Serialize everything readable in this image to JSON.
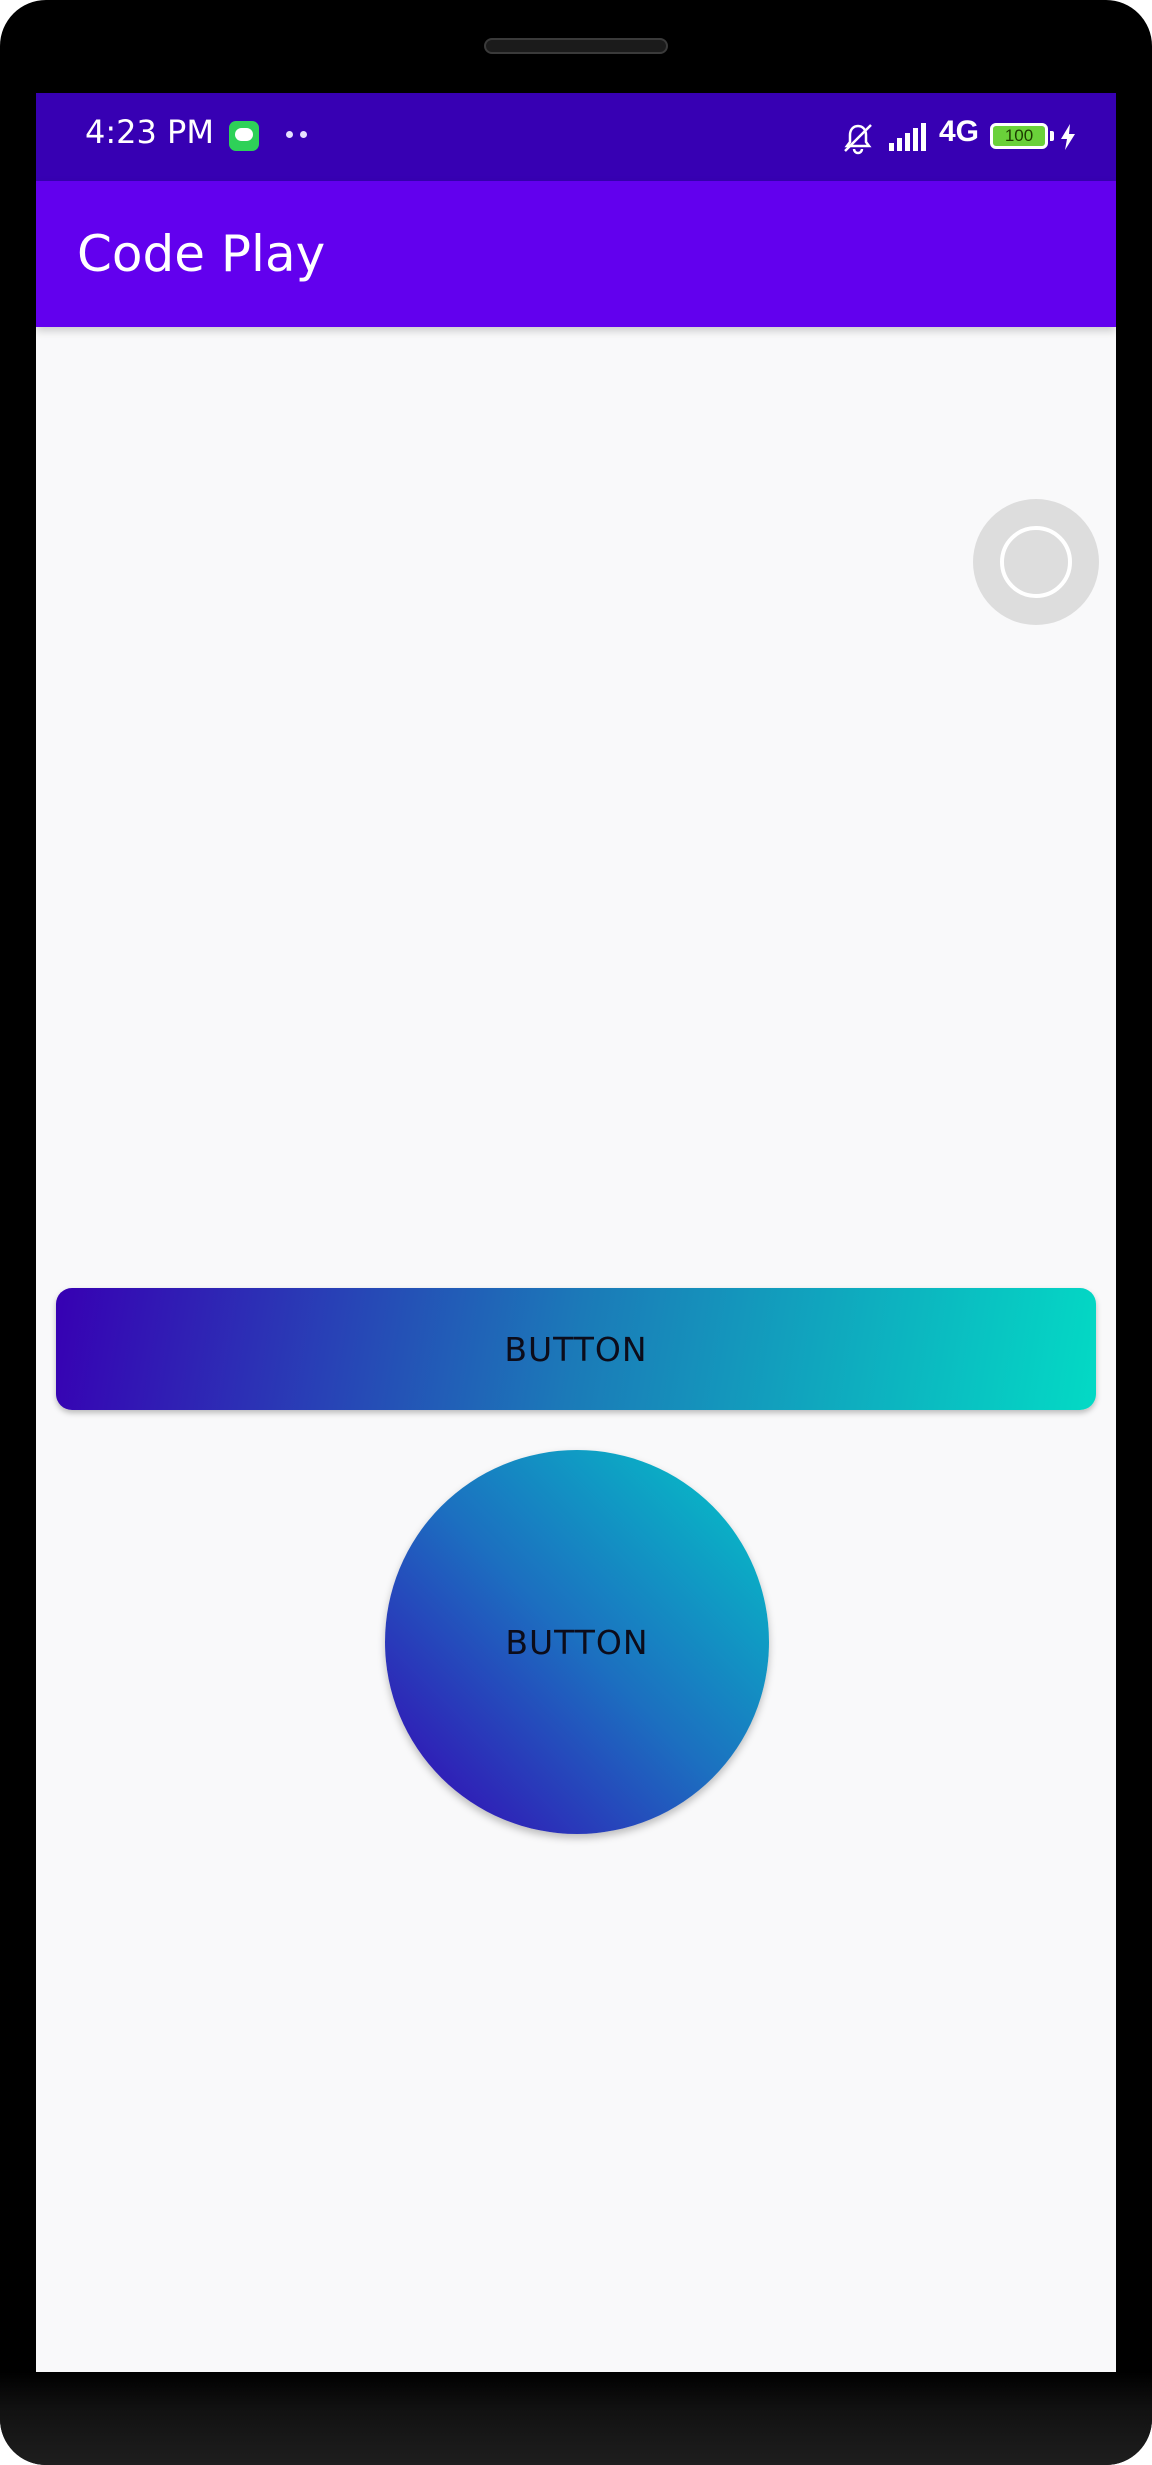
{
  "status_bar": {
    "time": "4:23 PM",
    "network": "4G",
    "battery": "100",
    "icons": [
      "message-icon",
      "overflow-dots-icon",
      "muted-bell-icon",
      "signal-icon",
      "battery-icon",
      "charging-bolt-icon"
    ]
  },
  "app_bar": {
    "title": "Code Play"
  },
  "main": {
    "gradient_button_label": "BUTTON",
    "circle_button_label": "BUTTON"
  },
  "colors": {
    "status_bar": "#3700b3",
    "app_bar": "#6200ee",
    "gradient_start": "#3700b3",
    "gradient_end": "#03dac5",
    "background": "#f9f9fa"
  }
}
